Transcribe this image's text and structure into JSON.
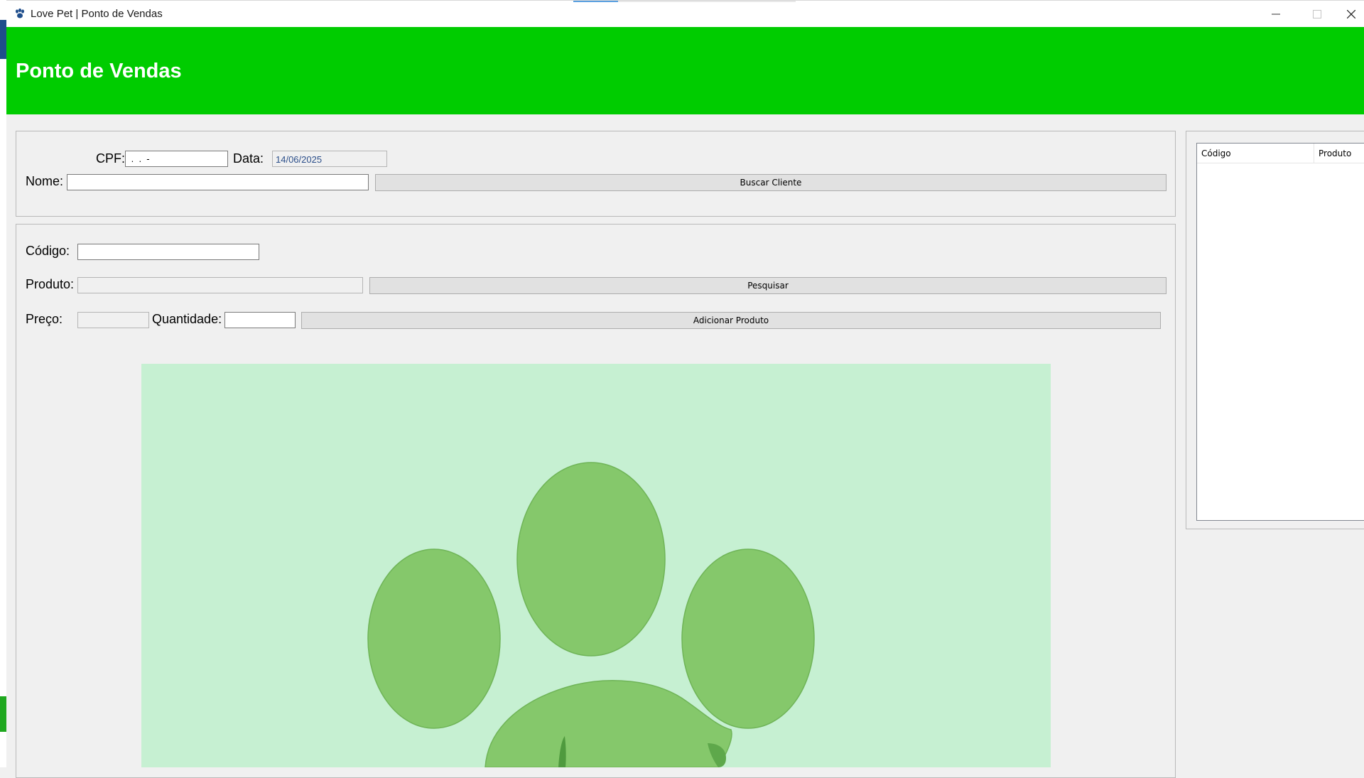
{
  "window": {
    "title": "Love Pet | Ponto de Vendas",
    "icon": "paw-icon",
    "controls": [
      "minimize-icon",
      "maximize-icon",
      "close-icon"
    ]
  },
  "header": {
    "title": "Ponto de Vendas",
    "background": "#00cc00"
  },
  "client": {
    "cpf_label": "CPF:",
    "cpf_value": " .  .  -",
    "date_label": "Data:",
    "date_value": "14/06/2025",
    "name_label": "Nome:",
    "name_value": "",
    "search_button": "Buscar Cliente"
  },
  "product": {
    "code_label": "Código:",
    "code_value": "",
    "product_label": "Produto:",
    "product_value": "",
    "search_button": "Pesquisar",
    "price_label": "Preço:",
    "price_value": "",
    "qty_label": "Quantidade:",
    "qty_value": "",
    "add_button": "Adicionar Produto"
  },
  "cart": {
    "columns": [
      "Código",
      "Produto"
    ]
  },
  "logo": {
    "name": "paw-logo",
    "background": "#c6f0d2",
    "pad_color": "#85c86b"
  }
}
